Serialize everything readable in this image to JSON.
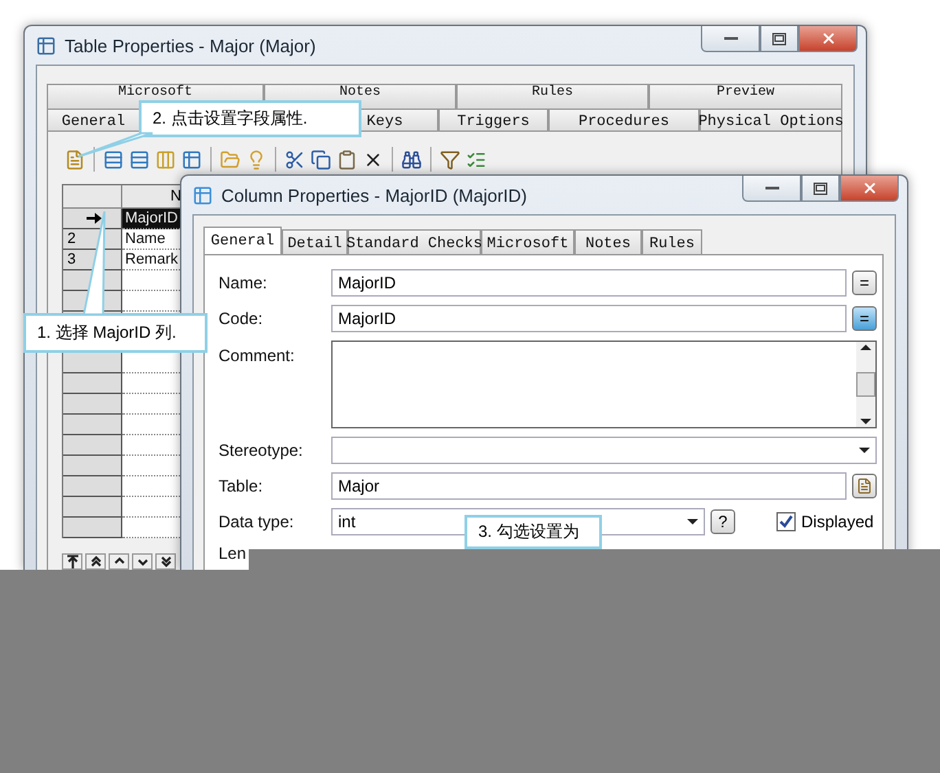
{
  "table_window": {
    "title": "Table Properties - Major (Major)",
    "tabs_row_1": [
      "Microsoft",
      "Notes",
      "Rules",
      "Preview"
    ],
    "tabs_row_2": [
      "General",
      "Keys",
      "Triggers",
      "Procedures",
      "Physical Options"
    ],
    "grid": {
      "columns": [
        "N"
      ],
      "rows": [
        {
          "number": "",
          "current": true,
          "name": "MajorID",
          "selected": true
        },
        {
          "number": "2",
          "current": false,
          "name": "Name",
          "selected": false
        },
        {
          "number": "3",
          "current": false,
          "name": "Remark",
          "selected": false
        }
      ]
    }
  },
  "column_window": {
    "title": "Column Properties - MajorID (MajorID)",
    "tabs": [
      {
        "label": "General",
        "selected": true
      },
      {
        "label": "Detail",
        "selected": false
      },
      {
        "label": "Standard Checks",
        "selected": false
      },
      {
        "label": "Microsoft",
        "selected": false
      },
      {
        "label": "Notes",
        "selected": false
      },
      {
        "label": "Rules",
        "selected": false
      }
    ],
    "fields": [
      {
        "label": "Name:",
        "kind": "text",
        "value": "MajorID",
        "button": "=",
        "button_highlighted": false
      },
      {
        "label": "Code:",
        "kind": "text",
        "value": "MajorID",
        "button": "=",
        "button_highlighted": true
      },
      {
        "label": "Comment:",
        "kind": "textarea"
      },
      {
        "label": "Stereotype:",
        "kind": "combo"
      },
      {
        "label": "Table:",
        "kind": "lookup",
        "value": "Major"
      },
      {
        "label": "Data type:",
        "kind": "datatype",
        "value": "int",
        "button": "?",
        "checkbox": {
          "label": "Displayed",
          "checked": true
        }
      },
      {
        "label": "Len",
        "kind": "cut"
      }
    ]
  },
  "callouts": [
    {
      "text": "2. 点击设置字段属性."
    },
    {
      "text": "1. 选择 MajorID 列."
    },
    {
      "text": "3. 勾选设置为"
    }
  ]
}
